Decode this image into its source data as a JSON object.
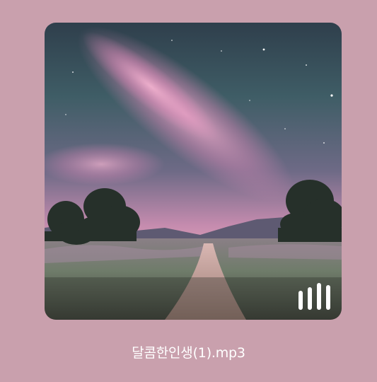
{
  "media": {
    "filename": "달콤한인생(1).mp3",
    "thumbnail_icon": "album-art-milky-way-landscape",
    "playing_indicator_icon": "equalizer-bars-icon",
    "equalizer_levels": [
      0.72,
      0.85,
      1.0,
      0.92
    ]
  },
  "colors": {
    "background": "#c9a0ad",
    "text": "#ffffff",
    "indicator": "#ffffff"
  }
}
